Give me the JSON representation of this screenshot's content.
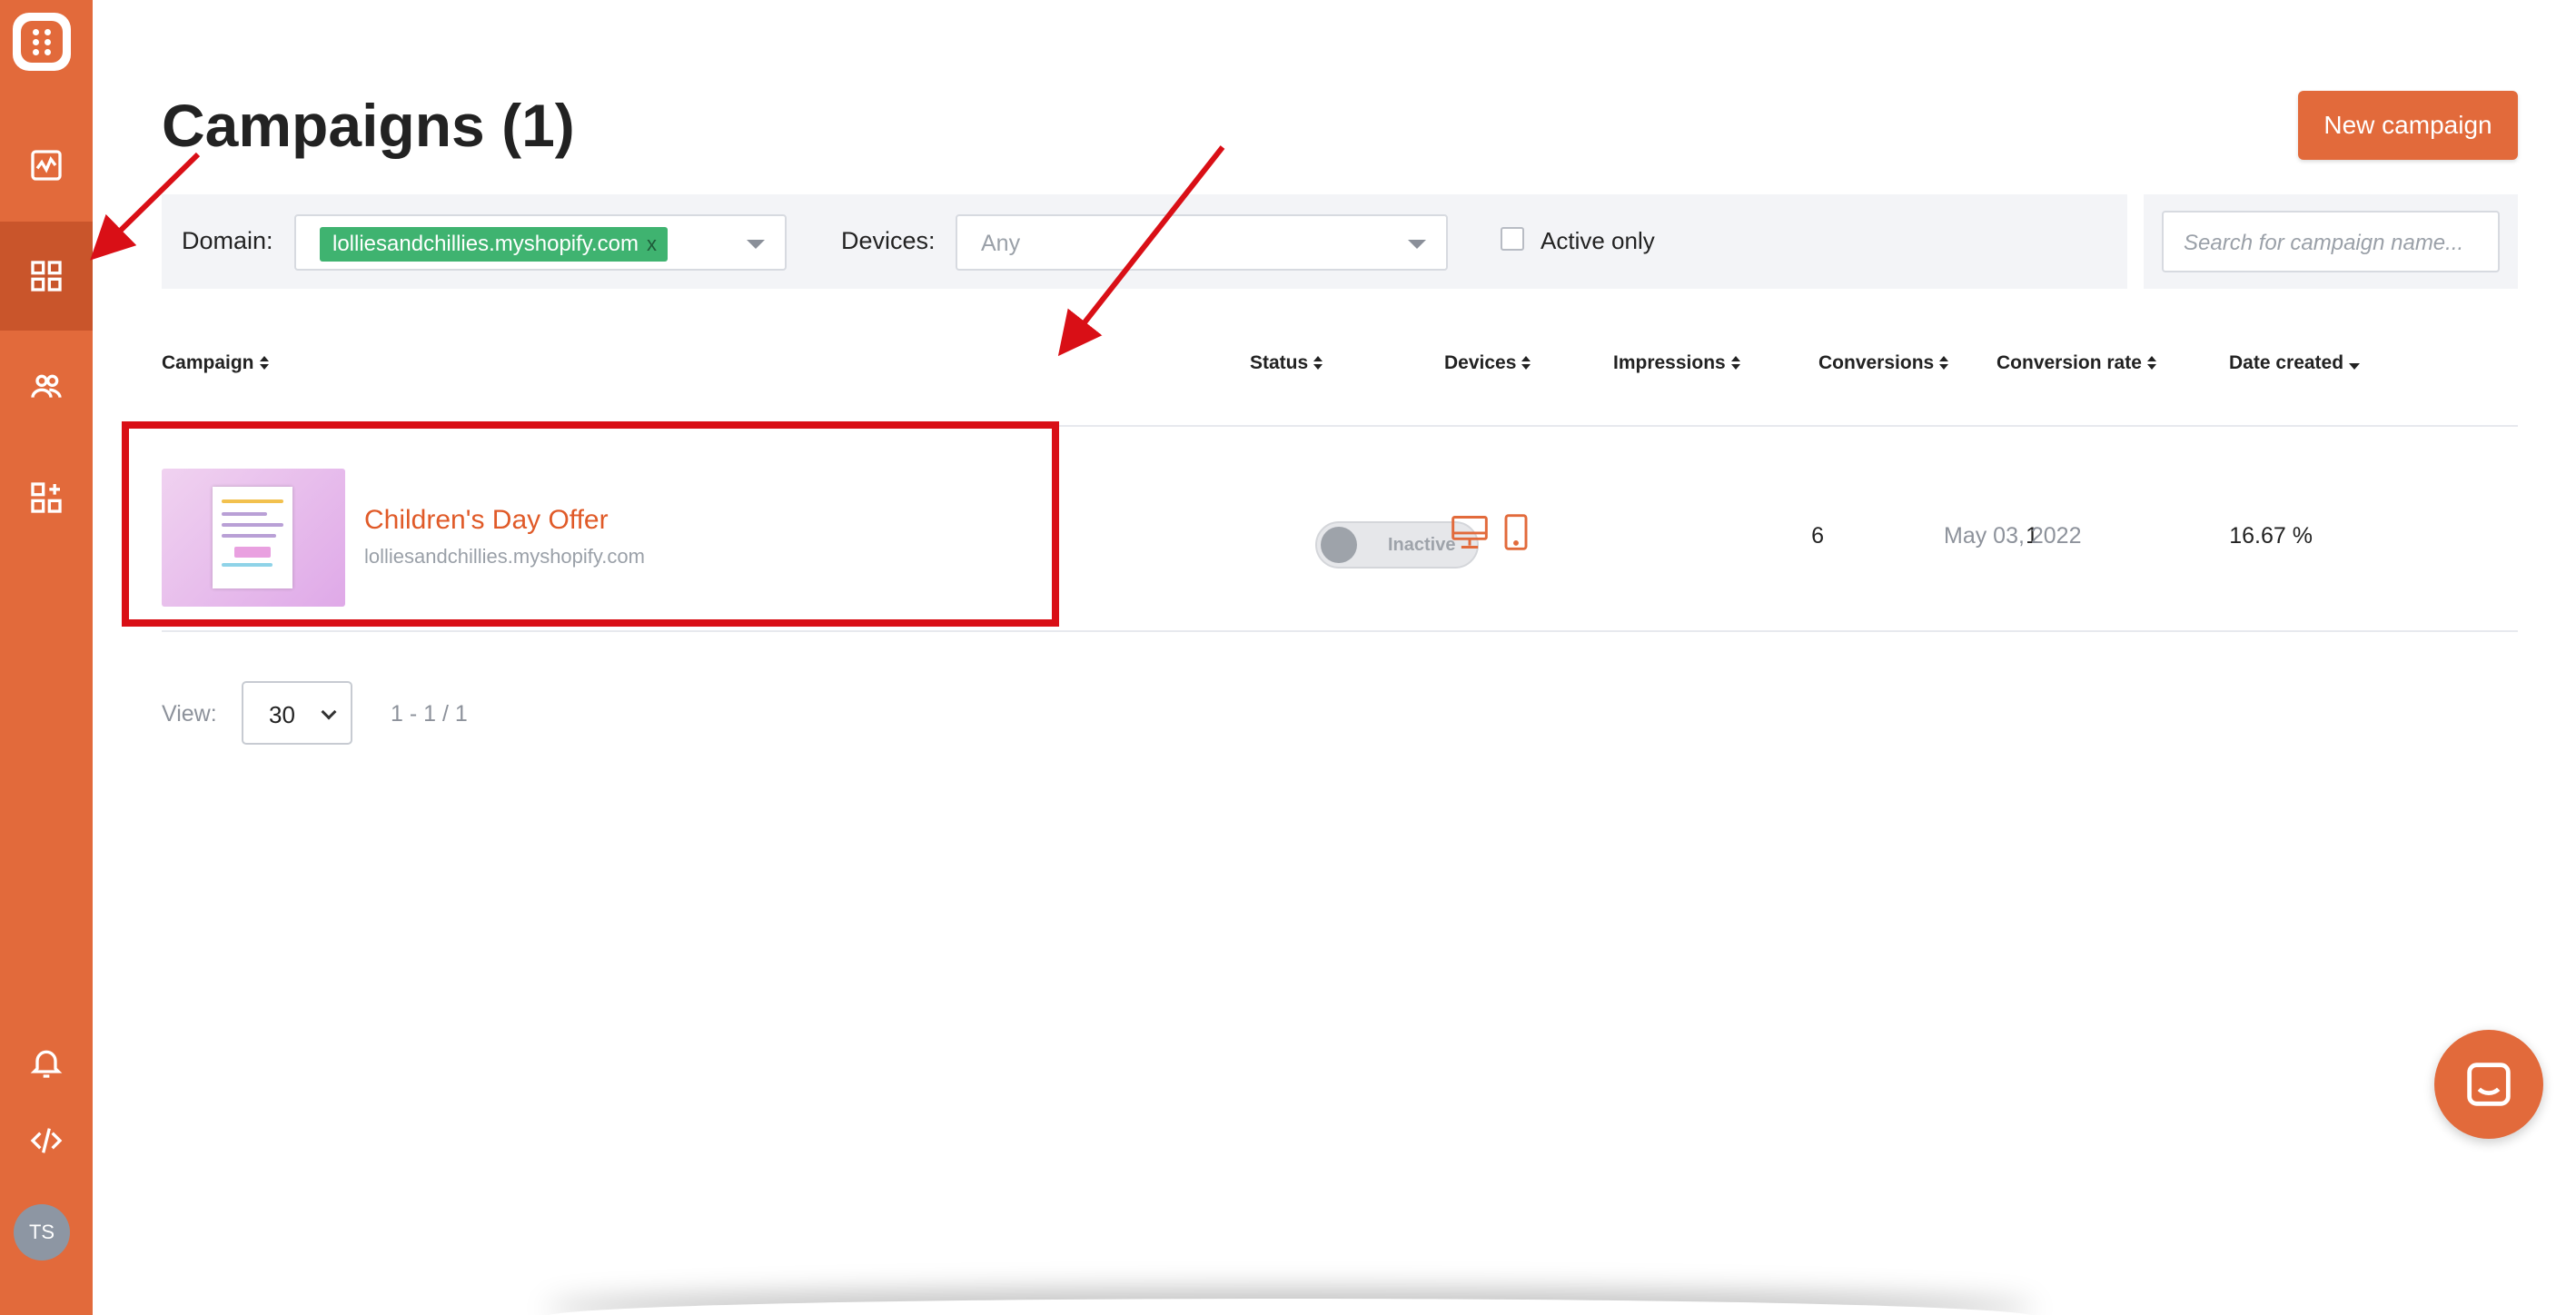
{
  "sidebar": {
    "avatar_initials": "TS"
  },
  "header": {
    "title": "Campaigns (1)",
    "new_button": "New campaign"
  },
  "filters": {
    "domain_label": "Domain:",
    "domain_tag": "lolliesandchillies.myshopify.com",
    "domain_tag_remove": "x",
    "devices_label": "Devices:",
    "devices_placeholder": "Any",
    "active_only_label": "Active only",
    "search_placeholder": "Search for campaign name..."
  },
  "table": {
    "columns": {
      "campaign": "Campaign",
      "status": "Status",
      "devices": "Devices",
      "impressions": "Impressions",
      "conversions": "Conversions",
      "conversion_rate": "Conversion rate",
      "date_created": "Date created"
    },
    "rows": [
      {
        "name": "Children's Day Offer",
        "domain": "lolliesandchillies.myshopify.com",
        "status": "Inactive",
        "impressions": "6",
        "conversions": "1",
        "conversion_rate": "16.67 %",
        "date_created": "May 03, 2022"
      }
    ]
  },
  "pagination": {
    "view_label": "View:",
    "page_size": "30",
    "range": "1 - 1 / 1"
  },
  "colors": {
    "brand": "#e26a3b",
    "accent_text": "#e05a28",
    "tag_green": "#3fb370",
    "annotation_red": "#d90f16"
  }
}
